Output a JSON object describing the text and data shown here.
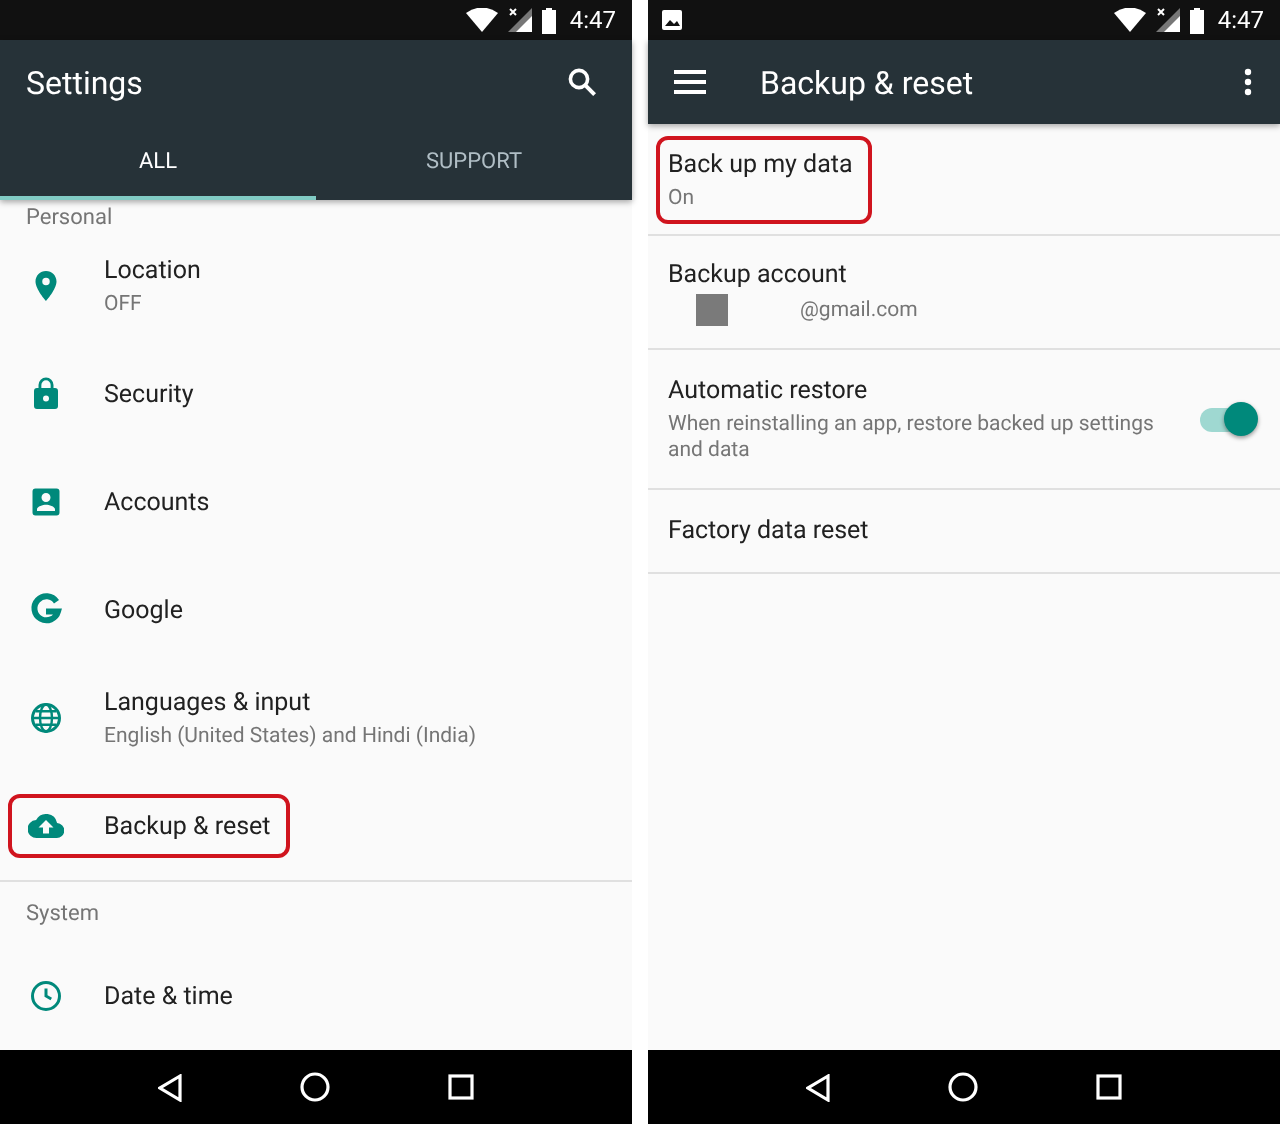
{
  "screens": [
    {
      "status_bar": {
        "time": "4:47"
      },
      "app_bar": {
        "title": "Settings"
      },
      "tabs": [
        {
          "label": "ALL",
          "selected": true
        },
        {
          "label": "SUPPORT",
          "selected": false
        }
      ],
      "list": [
        {
          "kind": "header",
          "label": "Personal"
        },
        {
          "kind": "item",
          "title": "Location",
          "subtitle": "OFF",
          "highlighted": false
        },
        {
          "kind": "item",
          "title": "Security",
          "highlighted": false
        },
        {
          "kind": "item",
          "title": "Accounts",
          "highlighted": false
        },
        {
          "kind": "item",
          "title": "Google",
          "highlighted": false
        },
        {
          "kind": "item",
          "title": "Languages & input",
          "subtitle": "English (United States) and Hindi (India)",
          "highlighted": false
        },
        {
          "kind": "item",
          "title": "Backup & reset",
          "highlighted": true
        },
        {
          "kind": "header",
          "label": "System"
        },
        {
          "kind": "item",
          "title": "Date & time",
          "highlighted": false
        }
      ]
    },
    {
      "status_bar": {
        "time": "4:47"
      },
      "app_bar": {
        "title": "Backup & reset"
      },
      "list": [
        {
          "kind": "item",
          "title": "Back up my data",
          "subtitle": "On",
          "highlighted": true
        },
        {
          "kind": "account",
          "title": "Backup account",
          "subtitle": "@gmail.com",
          "highlighted": false
        },
        {
          "kind": "switch",
          "title": "Automatic restore",
          "subtitle": "When reinstalling an app, restore backed up settings and data",
          "on": true,
          "highlighted": false
        },
        {
          "kind": "item",
          "title": "Factory data reset",
          "highlighted": false
        }
      ]
    }
  ]
}
